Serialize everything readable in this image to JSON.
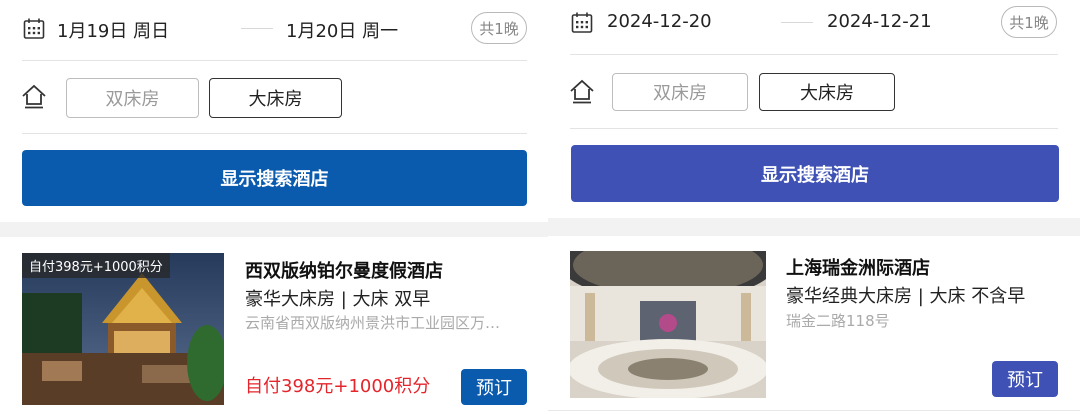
{
  "left": {
    "checkin": "1月19日  周日",
    "checkout": "1月20日  周一",
    "nights": "共1晚",
    "room_twin": "双床房",
    "room_king": "大床房",
    "search_label": "显示搜索酒店",
    "search_color": "#0a5aae",
    "hotel": {
      "price_tag": "自付398元+1000积分",
      "name": "西双版纳铂尔曼度假酒店",
      "room": "豪华大床房 | 大床  双早",
      "address": "云南省西双版纳州景洪市工业园区万…",
      "price": "自付398元+1000积分",
      "book_label": "预订",
      "book_color": "#0a5aae"
    }
  },
  "right": {
    "checkin": "2024-12-20",
    "checkout": "2024-12-21",
    "nights": "共1晚",
    "room_twin": "双床房",
    "room_king": "大床房",
    "search_label": "显示搜索酒店",
    "search_color": "#3f51b5",
    "hotel": {
      "name": "上海瑞金洲际酒店",
      "room": "豪华经典大床房 | 大床  不含早",
      "address": "瑞金二路118号",
      "book_label": "预订",
      "book_color": "#3f51b5"
    }
  },
  "icons": {
    "calendar": "calendar-icon",
    "house": "house-icon"
  }
}
